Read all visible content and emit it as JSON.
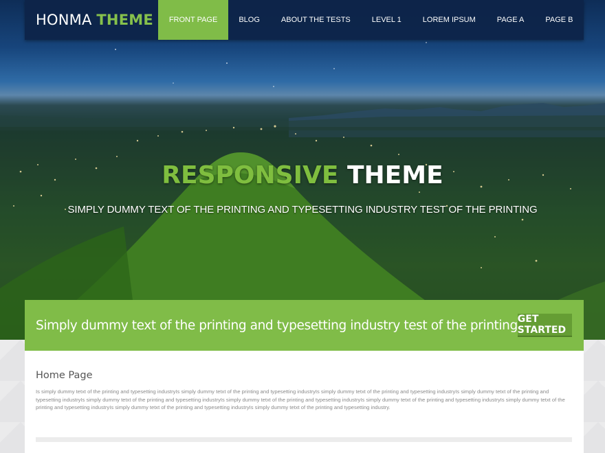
{
  "header": {
    "logo": {
      "part1": "HONMA",
      "part2": "THEME"
    },
    "nav": [
      {
        "label": "FRONT PAGE",
        "active": true
      },
      {
        "label": "BLOG",
        "active": false
      },
      {
        "label": "ABOUT THE TESTS",
        "active": false
      },
      {
        "label": "LEVEL 1",
        "active": false
      },
      {
        "label": "LOREM IPSUM",
        "active": false
      },
      {
        "label": "PAGE A",
        "active": false
      },
      {
        "label": "PAGE B",
        "active": false
      }
    ]
  },
  "hero": {
    "title_part1": "RESPONSIVE",
    "title_part2": "THEME",
    "subtitle": "SIMPLY DUMMY TEXT OF THE PRINTING AND TYPESETTING INDUSTRY TEST OF THE PRINTING"
  },
  "cta": {
    "text": "Simply dummy text of the printing and typesetting industry test of the printing",
    "button_label": "GET STARTED"
  },
  "content": {
    "heading": "Home Page",
    "body": "Is simply dummy tetxt of the printing and typesetting industryIs simply dummy tetxt of the printing and typesetting industryIs simply dummy tetxt of the printing and typesetting industryIs simply dummy tetxt of the printing and typesetting industryIs simply dummy tetxt of the printing and typesetting industryIs simply dummy tetxt of the printing and typesetting industryIs simply dummy tetxt of the printing and typesetting industryIs simply dummy tetxt of the printing and typesetting industryIs simply dummy tetxt of the printing and typesetting industryIs simply dummy tetxt of the printing and typesetting industry."
  },
  "colors": {
    "accent_green": "#80bc48",
    "button_green": "#659d34",
    "nav_bg": "#0d2348"
  }
}
